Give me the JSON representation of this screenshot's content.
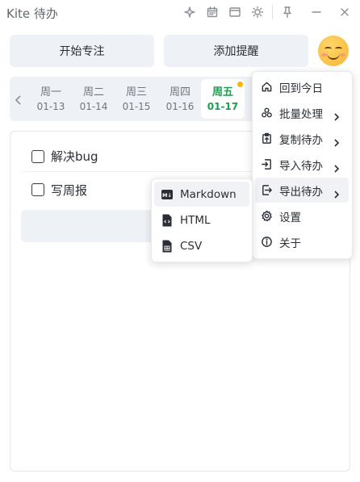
{
  "window": {
    "title": "Kite 待办",
    "icons": [
      "sparkle-icon",
      "calendar-icon",
      "window-icon",
      "sun-icon",
      "pin-icon",
      "minimize-icon",
      "close-icon"
    ]
  },
  "actions": {
    "focus_label": "开始专注",
    "remind_label": "添加提醒"
  },
  "week": {
    "days": [
      {
        "weekday": "周一",
        "date": "01-13"
      },
      {
        "weekday": "周二",
        "date": "01-14"
      },
      {
        "weekday": "周三",
        "date": "01-15"
      },
      {
        "weekday": "周四",
        "date": "01-16"
      },
      {
        "weekday": "周五",
        "date": "01-17"
      }
    ],
    "selected_index": 4,
    "accent_color": "#1f9d4c",
    "dot_color": "#f5b800"
  },
  "todos": [
    {
      "text": "解决bug",
      "done": false
    },
    {
      "text": "写周报",
      "done": false
    }
  ],
  "menu": {
    "items": [
      {
        "label": "回到今日",
        "icon": "home-icon",
        "has_submenu": false
      },
      {
        "label": "批量处理",
        "icon": "batch-icon",
        "has_submenu": true
      },
      {
        "label": "复制待办",
        "icon": "copy-icon",
        "has_submenu": true
      },
      {
        "label": "导入待办",
        "icon": "import-icon",
        "has_submenu": true
      },
      {
        "label": "导出待办",
        "icon": "export-icon",
        "has_submenu": true
      },
      {
        "label": "设置",
        "icon": "gear-icon",
        "has_submenu": false
      },
      {
        "label": "关于",
        "icon": "info-icon",
        "has_submenu": false
      }
    ],
    "hovered_index": 4
  },
  "export_submenu": {
    "items": [
      {
        "label": "Markdown",
        "icon": "markdown-file-icon"
      },
      {
        "label": "HTML",
        "icon": "html-file-icon"
      },
      {
        "label": "CSV",
        "icon": "csv-file-icon"
      }
    ],
    "hovered_index": 0
  }
}
